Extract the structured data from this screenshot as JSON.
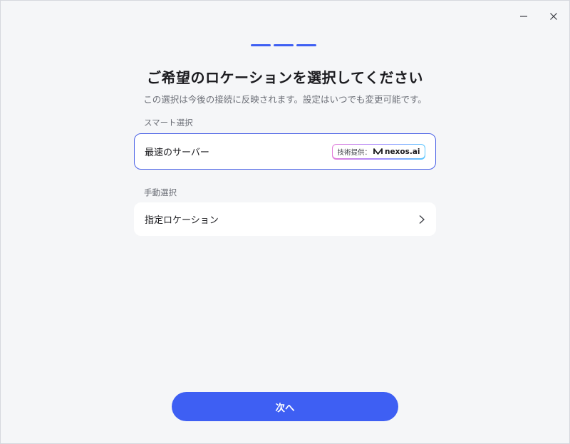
{
  "colors": {
    "accent": "#3e5ff3",
    "step_active": "#3e5ff3",
    "step_inactive": "#3e5ff3"
  },
  "window_controls": {
    "minimize_icon": "minimize-icon",
    "close_icon": "close-icon"
  },
  "header": {
    "title": "ご希望のロケーションを選択してください",
    "subtitle": "この選択は今後の接続に反映されます。設定はいつでも変更可能です。"
  },
  "smart": {
    "section_label": "スマート選択",
    "option_label": "最速のサーバー",
    "badge_prefix": "技術提供：",
    "badge_brand": "nexos.ai",
    "badge_icon": "nexos-logo-icon"
  },
  "manual": {
    "section_label": "手動選択",
    "option_label": "指定ロケーション",
    "chevron_icon": "chevron-right-icon"
  },
  "footer": {
    "next_label": "次へ"
  }
}
